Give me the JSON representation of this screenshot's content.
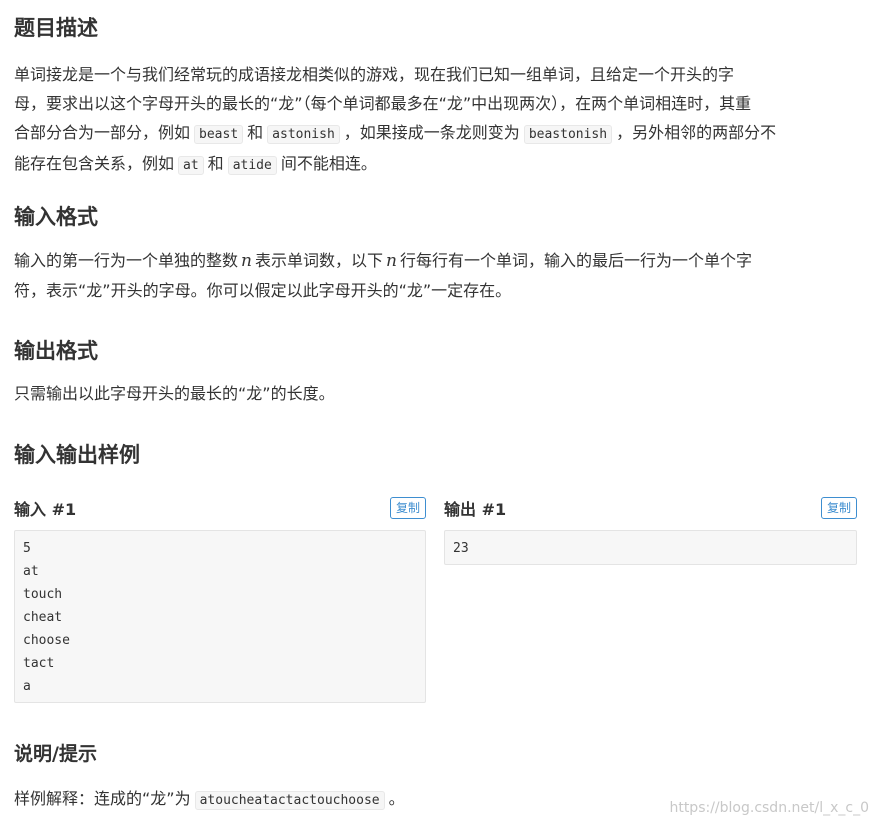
{
  "description": {
    "heading": "题目描述",
    "line1": "单词接龙是一个与我们经常玩的成语接龙相类似的游戏，现在我们已知一组单词，且给定一个开头的字",
    "line2": "母，要求出以这个字母开头的最长的“龙”（每个单词都最多在“龙”中出现两次），在两个单词相连时，其重",
    "line3_a": "合部分合为一部分，例如",
    "code_beast": "beast",
    "line3_and": "和",
    "code_astonish": "astonish",
    "line3_b": "，如果接成一条龙则变为",
    "code_beastonish": "beastonish",
    "line3_c": "，另外相邻的两部分不",
    "line4_a": "能存在包含关系，例如",
    "code_at": "at",
    "line4_and": "和",
    "code_atide": "atide",
    "line4_b": "间不能相连。"
  },
  "input_format": {
    "heading": "输入格式",
    "text_a": "输入的第一行为一个单独的整数",
    "var_n": "n",
    "text_b": "表示单词数，以下",
    "text_c": "行每行有一个单词，输入的最后一行为一个单个字",
    "line2": "符，表示“龙”开头的字母。你可以假定以此字母开头的“龙”一定存在。"
  },
  "output_format": {
    "heading": "输出格式",
    "text": "只需输出以此字母开头的最长的“龙”的长度。"
  },
  "samples": {
    "heading": "输入输出样例",
    "input_title": "输入 #1",
    "output_title": "输出 #1",
    "copy_label": "复制",
    "input_lines": [
      "5",
      "at",
      "touch",
      "cheat",
      "choose",
      "tact",
      "a"
    ],
    "output_lines": [
      "23"
    ]
  },
  "hint": {
    "heading": "说明/提示",
    "text_a": "样例解释：连成的“龙”为",
    "code": "atoucheatactactouchoose",
    "text_b": "。"
  },
  "watermark": "https://blog.csdn.net/l_x_c_0"
}
